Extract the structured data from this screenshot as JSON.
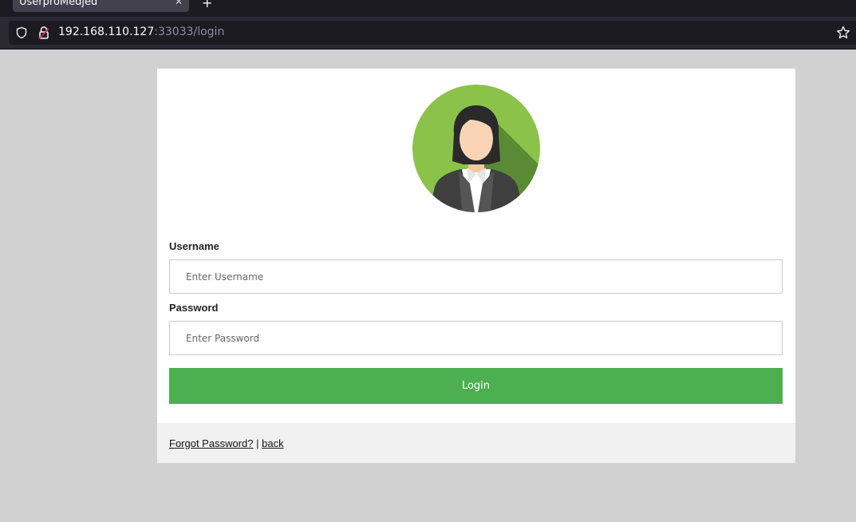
{
  "browser": {
    "tab_title": "UserproMedjed",
    "tab_close": "✕",
    "new_tab": "+",
    "url_host": "192.168.110.127",
    "url_rest": ":33033/login"
  },
  "login_form": {
    "username_label": "Username",
    "username_placeholder": "Enter Username",
    "password_label": "Password",
    "password_placeholder": "Enter Password",
    "login_label": "Login"
  },
  "footer": {
    "forgot_label": "Forgot Password?",
    "separator": "|",
    "back_label": "back"
  },
  "colors": {
    "page_bg": "#d1d1d1",
    "login_button": "#4caf50",
    "avatar_bg": "#8bc34a"
  }
}
